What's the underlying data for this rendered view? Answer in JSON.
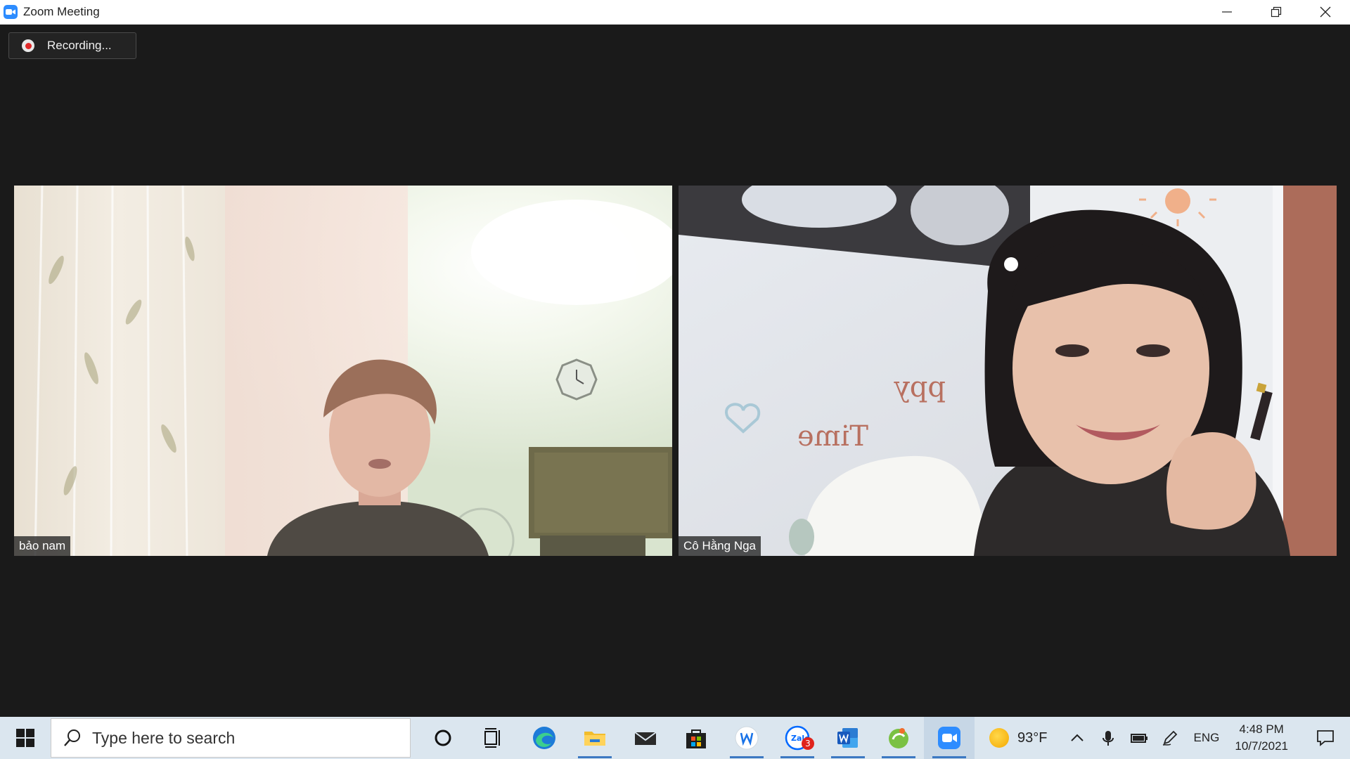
{
  "window": {
    "title": "Zoom Meeting"
  },
  "meeting": {
    "recording_label": "Recording...",
    "participants": [
      {
        "name": "bảo nam"
      },
      {
        "name": "Cô Hằng Nga"
      }
    ]
  },
  "taskbar": {
    "search_placeholder": "Type here to search",
    "apps": [
      "cortana-icon",
      "task-view-icon",
      "edge-icon",
      "file-explorer-icon",
      "mail-icon",
      "store-icon",
      "w-app-icon",
      "zalo-icon",
      "word-icon",
      "green-app-icon",
      "zoom-icon"
    ],
    "zalo_badge": "3",
    "weather_temp": "93°F",
    "language": "ENG",
    "time": "4:48 PM",
    "date": "10/7/2021"
  },
  "colors": {
    "accent": "#2d8cff",
    "background": "#1a1a1a",
    "taskbar": "#dbe6ef",
    "recording": "#e02828"
  }
}
